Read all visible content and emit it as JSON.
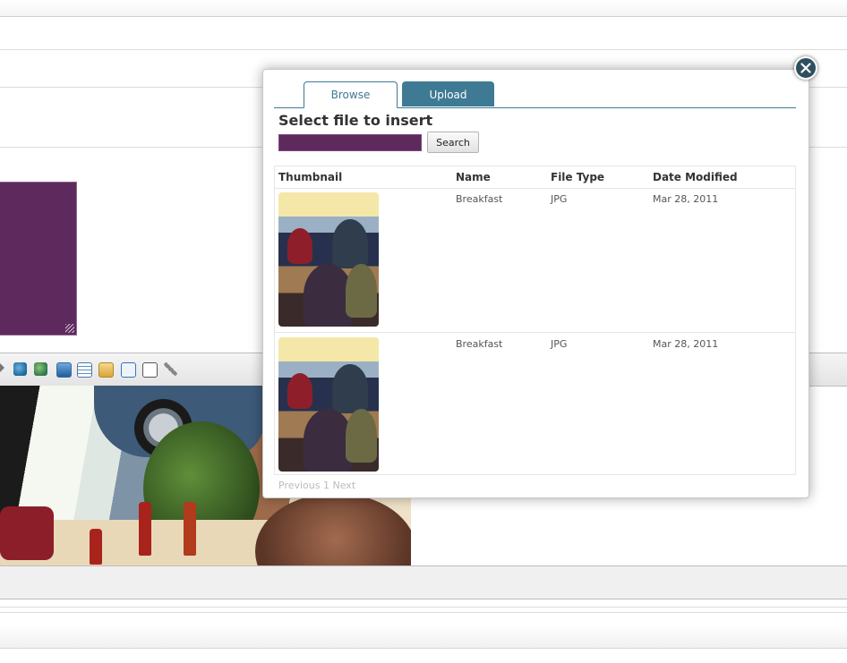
{
  "dialog": {
    "tabs": [
      {
        "label": "Browse",
        "active": true
      },
      {
        "label": "Upload",
        "active": false
      }
    ],
    "heading": "Select file to insert",
    "search": {
      "value": "",
      "button_label": "Search"
    },
    "table": {
      "columns": [
        "Thumbnail",
        "Name",
        "File Type",
        "Date Modified"
      ],
      "rows": [
        {
          "name": "Breakfast",
          "file_type": "JPG",
          "date_modified": "Mar 28, 2011"
        },
        {
          "name": "Breakfast",
          "file_type": "JPG",
          "date_modified": "Mar 28, 2011"
        }
      ]
    },
    "pagination": {
      "previous": "Previous",
      "page": "1",
      "next": "Next"
    }
  },
  "editor_toolbar": {
    "icons": [
      "link-icon",
      "unlink-icon",
      "image-icon",
      "table-icon",
      "paste-icon",
      "source-code-icon",
      "preview-icon",
      "attach-icon"
    ]
  },
  "colors": {
    "accent": "#3e7a93",
    "swatch": "#5e2a5e",
    "close_button": "#2f4f5f"
  }
}
